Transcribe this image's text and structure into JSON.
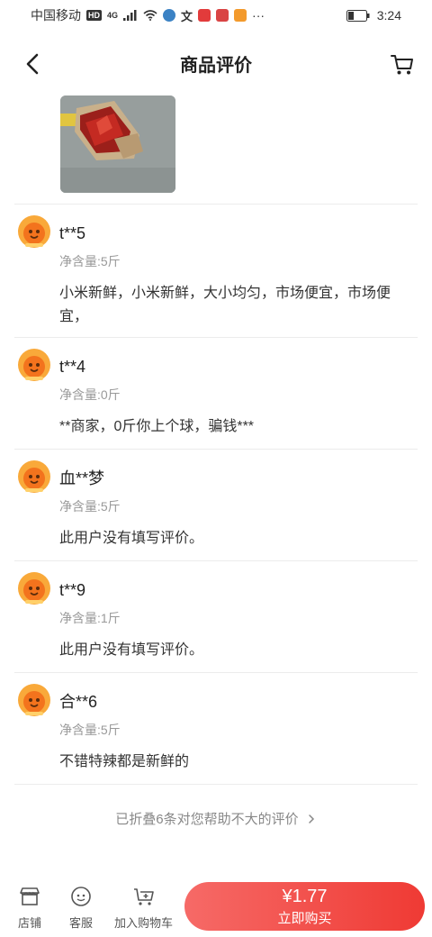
{
  "status_bar": {
    "carrier": "中国移动",
    "hd_badge": "HD",
    "network": "4G",
    "time": "3:24",
    "more": "···"
  },
  "header": {
    "title": "商品评价",
    "back_icon": "chevron-left-icon",
    "cart_icon": "cart-icon"
  },
  "reviews": [
    {
      "user": "t**5",
      "spec": "净含量:5斤",
      "content": "小米新鲜，小米新鲜，大小均匀，市场便宜，市场便宜，"
    },
    {
      "user": "t**4",
      "spec": "净含量:0斤",
      "content": "**商家，0斤你上个球，骗钱***"
    },
    {
      "user": "血**梦",
      "spec": "净含量:5斤",
      "content": "此用户没有填写评价。"
    },
    {
      "user": "t**9",
      "spec": "净含量:1斤",
      "content": "此用户没有填写评价。"
    },
    {
      "user": "合**6",
      "spec": "净含量:5斤",
      "content": "不错特辣都是新鲜的"
    }
  ],
  "folded_notice": "已折叠6条对您帮助不大的评价",
  "bottom_bar": {
    "shop_label": "店铺",
    "service_label": "客服",
    "add_cart_label": "加入购物车",
    "price": "¥1.77",
    "buy_label": "立即购买"
  },
  "colors": {
    "accent": "#ef3a34",
    "accent_light": "#f66a67",
    "avatar": "#f7931e"
  }
}
